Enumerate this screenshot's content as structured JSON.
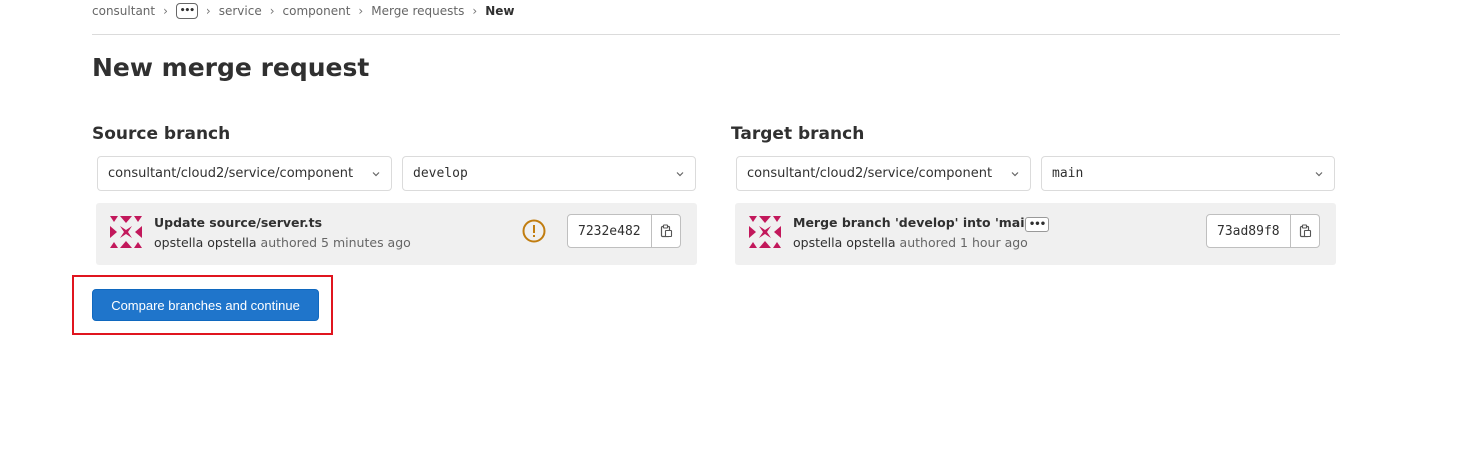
{
  "breadcrumb": {
    "items": [
      "consultant",
      "service",
      "component",
      "Merge requests"
    ],
    "more": "•••",
    "current": "New",
    "separator": "›"
  },
  "page_title": "New merge request",
  "source": {
    "heading": "Source branch",
    "project": "consultant/cloud2/service/component",
    "branch": "develop",
    "commit": {
      "title": "Update source/server.ts",
      "author": "opstella opstella",
      "meta": " authored 5 minutes ago",
      "sha": "7232e482",
      "status_icon": "warning-circle-icon"
    }
  },
  "target": {
    "heading": "Target branch",
    "project": "consultant/cloud2/service/component",
    "branch": "main",
    "commit": {
      "title": "Merge branch 'develop' into 'main'",
      "more": "•••",
      "author": "opstella opstella",
      "meta": " authored 1 hour ago",
      "sha": "73ad89f8"
    }
  },
  "compare_button": "Compare branches and continue",
  "colors": {
    "primary": "#1f75cb",
    "warning": "#c17d10",
    "avatar": "#c2185b",
    "highlight": "#e0151f"
  }
}
